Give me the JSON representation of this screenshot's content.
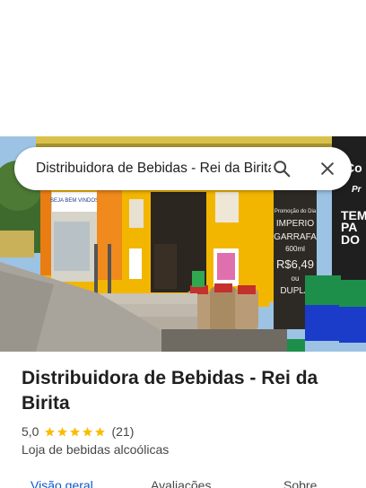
{
  "search": {
    "query": "Distribuidora de Bebidas - Rei da Birita",
    "search_button_icon": "search-icon",
    "close_button_icon": "close-icon"
  },
  "photo": {
    "sign_left": "SEJA BEM VINDOS",
    "board_lines": [
      "Promoção do Dia",
      "IMPERIO",
      "GARRAFA",
      "600ml",
      "R$6,49",
      "ou",
      "DUPLA"
    ],
    "right_sign": [
      "Co",
      "Pr",
      "TEM",
      "PA",
      "DO"
    ]
  },
  "place": {
    "name": "Distribuidora de Bebidas - Rei da Birita",
    "rating": "5,0",
    "rating_value": 5.0,
    "stars_count": 5,
    "review_count": "(21)",
    "category": "Loja de bebidas alcoólicas"
  },
  "tabs": [
    {
      "label": "Visão geral",
      "active": true
    },
    {
      "label": "Avaliações",
      "active": false
    },
    {
      "label": "Sobre",
      "active": false
    }
  ],
  "colors": {
    "accent": "#0b57d0",
    "star": "#fbbc04",
    "wall_orange": "#f08a1c",
    "wall_yellow": "#f3b600"
  }
}
